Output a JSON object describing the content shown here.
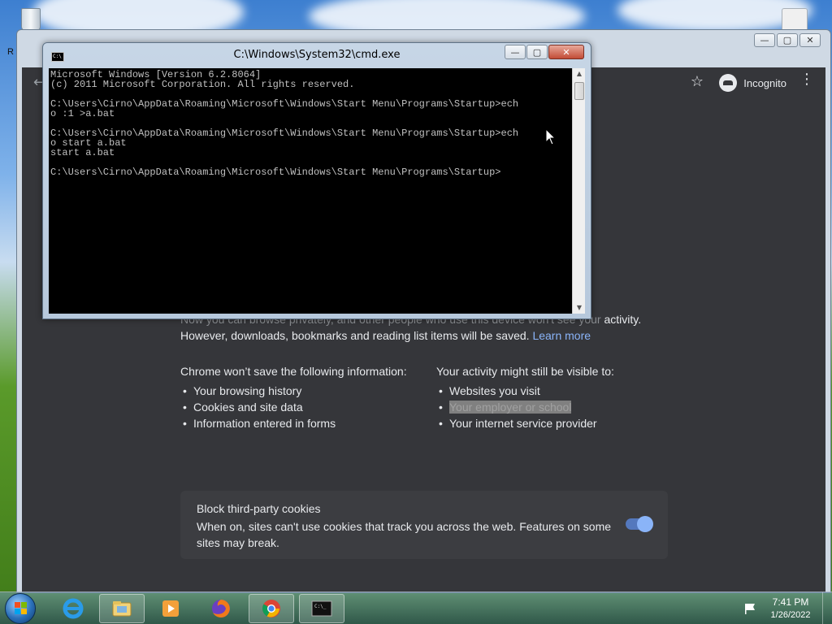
{
  "desktop": {
    "left_letter": "R"
  },
  "chrome": {
    "caption_buttons": {
      "minimize": "—",
      "maximize": "▢",
      "close": "✕"
    },
    "toolbar": {
      "back_icon": "back-arrow-icon",
      "star_icon": "star-icon",
      "incognito_label": "Incognito",
      "menu_icon": "menu-dots-icon"
    },
    "page": {
      "intro_line1_faded": "Now you can browse privately, and other people who use this device won't see your",
      "intro_line1_end": " activity.",
      "intro_line2": "However, downloads, bookmarks and reading list items will be saved. ",
      "learn_more": "Learn more",
      "left_heading": "Chrome won’t save the following information:",
      "left_items": [
        "Your browsing history",
        "Cookies and site data",
        "Information entered in forms"
      ],
      "right_heading": "Your activity might still be visible to:",
      "right_items": [
        "Websites you visit",
        "Your employer or school",
        "Your internet service provider"
      ],
      "cookie_title": "Block third-party cookies",
      "cookie_desc": "When on, sites can't use cookies that track you across the web. Features on some sites may break.",
      "cookie_toggle_on": true
    }
  },
  "cmd": {
    "title": "C:\\Windows\\System32\\cmd.exe",
    "icon_text": "C:\\",
    "lines": [
      "Microsoft Windows [Version 6.2.8064]",
      "(c) 2011 Microsoft Corporation. All rights reserved.",
      "",
      "C:\\Users\\Cirno\\AppData\\Roaming\\Microsoft\\Windows\\Start Menu\\Programs\\Startup>ech",
      "o :1 >a.bat",
      "",
      "C:\\Users\\Cirno\\AppData\\Roaming\\Microsoft\\Windows\\Start Menu\\Programs\\Startup>ech",
      "o start a.bat",
      "start a.bat",
      "",
      "C:\\Users\\Cirno\\AppData\\Roaming\\Microsoft\\Windows\\Start Menu\\Programs\\Startup>"
    ],
    "buttons": {
      "minimize": "—",
      "maximize": "▢",
      "close": "✕"
    }
  },
  "taskbar": {
    "apps": [
      {
        "name": "internet-explorer-icon",
        "color": "#1e8fe0"
      },
      {
        "name": "file-explorer-icon",
        "color": "#e6c25a"
      },
      {
        "name": "media-player-icon",
        "color": "#e8903a"
      },
      {
        "name": "firefox-icon",
        "color": "#e8601c"
      },
      {
        "name": "chrome-icon",
        "color": "#3a9d4a"
      },
      {
        "name": "cmd-icon",
        "color": "#111111"
      }
    ],
    "clock_time": "7:41 PM",
    "clock_date": "1/26/2022"
  }
}
